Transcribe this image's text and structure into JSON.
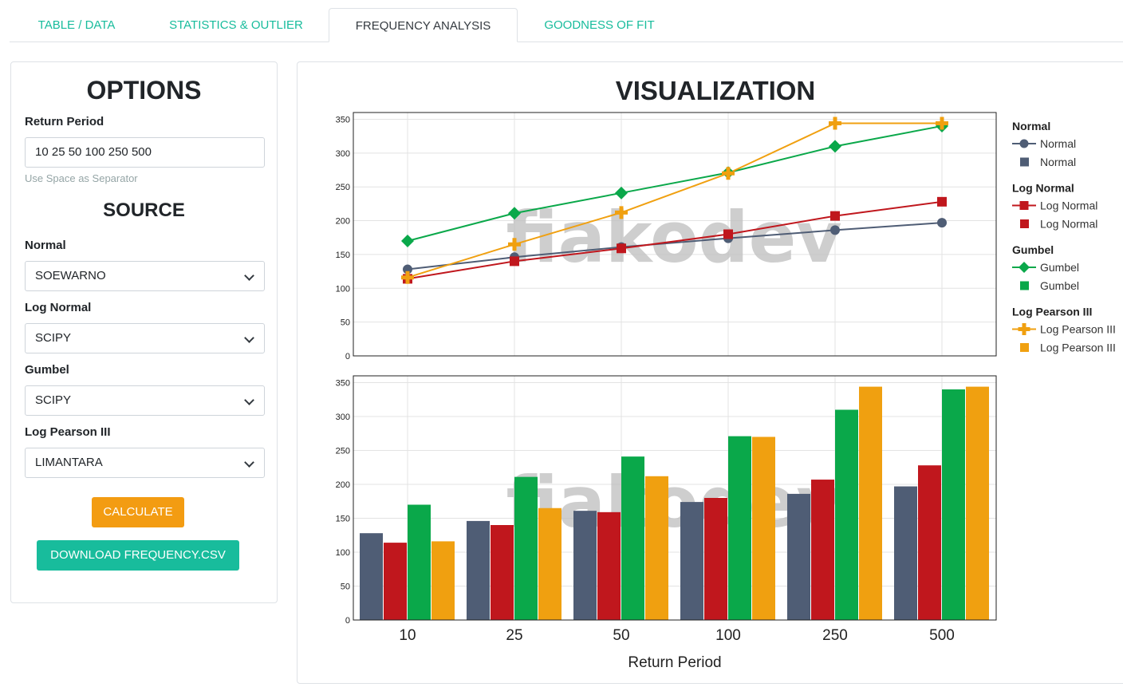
{
  "tabs": [
    {
      "label": "TABLE / DATA"
    },
    {
      "label": "STATISTICS & OUTLIER"
    },
    {
      "label": "FREQUENCY ANALYSIS"
    },
    {
      "label": "GOODNESS OF FIT"
    }
  ],
  "active_tab": "FREQUENCY ANALYSIS",
  "options": {
    "title": "OPTIONS",
    "return_period_label": "Return Period",
    "return_period_value": "10 25 50 100 250 500",
    "hint": "Use Space as Separator",
    "source_title": "SOURCE",
    "sources": [
      {
        "label": "Normal",
        "value": "SOEWARNO"
      },
      {
        "label": "Log Normal",
        "value": "SCIPY"
      },
      {
        "label": "Gumbel",
        "value": "SCIPY"
      },
      {
        "label": "Log Pearson III",
        "value": "LIMANTARA"
      }
    ],
    "calculate_label": "CALCULATE",
    "download_label": "DOWNLOAD FREQUENCY.CSV"
  },
  "visualization": {
    "title": "VISUALIZATION",
    "watermark": "fiakodev"
  },
  "colors": {
    "accent": "#18bc9c",
    "warning": "#f39c12",
    "normal": "#4f5d75",
    "lognormal": "#c0171d",
    "gumbel": "#0aa84a",
    "logpearson": "#f0a010"
  },
  "chart_data": [
    {
      "type": "line",
      "categories": [
        "10",
        "25",
        "50",
        "100",
        "250",
        "500"
      ],
      "ylim": [
        0,
        360
      ],
      "yticks": [
        0,
        50,
        100,
        150,
        200,
        250,
        300,
        350
      ],
      "series": [
        {
          "name": "Normal",
          "values": [
            128,
            146,
            161,
            174,
            186,
            197
          ]
        },
        {
          "name": "Log Normal",
          "values": [
            114,
            140,
            159,
            180,
            207,
            228
          ]
        },
        {
          "name": "Gumbel",
          "values": [
            170,
            211,
            241,
            271,
            310,
            340
          ]
        },
        {
          "name": "Log Pearson III",
          "values": [
            116,
            165,
            212,
            270,
            344,
            344
          ]
        }
      ],
      "legend": "right"
    },
    {
      "type": "bar",
      "categories": [
        "10",
        "25",
        "50",
        "100",
        "250",
        "500"
      ],
      "ylim": [
        0,
        360
      ],
      "yticks": [
        0,
        50,
        100,
        150,
        200,
        250,
        300,
        350
      ],
      "xlabel": "Return Period",
      "series": [
        {
          "name": "Normal",
          "values": [
            128,
            146,
            161,
            174,
            186,
            197
          ]
        },
        {
          "name": "Log Normal",
          "values": [
            114,
            140,
            159,
            180,
            207,
            228
          ]
        },
        {
          "name": "Gumbel",
          "values": [
            170,
            211,
            241,
            271,
            310,
            340
          ]
        },
        {
          "name": "Log Pearson III",
          "values": [
            116,
            165,
            212,
            270,
            344,
            344
          ]
        }
      ]
    }
  ],
  "legend_groups": [
    {
      "title": "Normal",
      "line_label": "Normal",
      "bar_label": "Normal"
    },
    {
      "title": "Log Normal",
      "line_label": "Log Normal",
      "bar_label": "Log Normal"
    },
    {
      "title": "Gumbel",
      "line_label": "Gumbel",
      "bar_label": "Gumbel"
    },
    {
      "title": "Log Pearson III",
      "line_label": "Log Pearson III",
      "bar_label": "Log Pearson III"
    }
  ]
}
